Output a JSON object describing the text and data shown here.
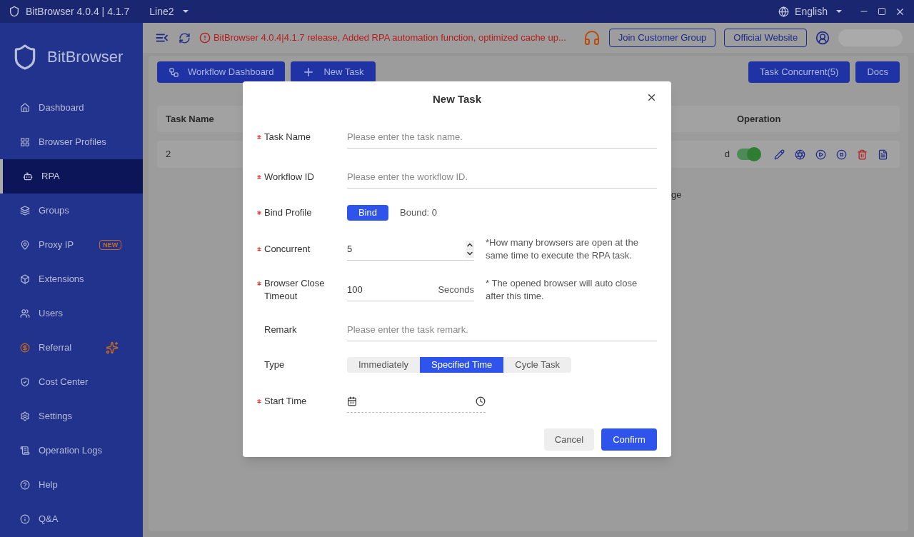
{
  "title_bar": {
    "app_title": "BitBrowser 4.0.4 | 4.1.7",
    "line_selector": "Line2",
    "language": "English"
  },
  "sidebar": {
    "brand": "BitBrowser",
    "items": [
      {
        "label": "Dashboard",
        "selected": false
      },
      {
        "label": "Browser Profiles",
        "selected": false
      },
      {
        "label": "RPA",
        "selected": true
      },
      {
        "label": "Groups",
        "selected": false
      },
      {
        "label": "Proxy IP",
        "selected": false,
        "badge": "NEW"
      },
      {
        "label": "Extensions",
        "selected": false
      },
      {
        "label": "Users",
        "selected": false
      },
      {
        "label": "Referral",
        "selected": false
      },
      {
        "label": "Cost Center",
        "selected": false
      },
      {
        "label": "Settings",
        "selected": false
      },
      {
        "label": "Operation Logs",
        "selected": false
      },
      {
        "label": "Help",
        "selected": false
      },
      {
        "label": "Q&A",
        "selected": false
      }
    ]
  },
  "toolbar": {
    "notice": "BitBrowser 4.0.4|4.1.7 release, Added RPA automation function, optimized cache up...",
    "buttons": [
      "Join Customer Group",
      "Official Website"
    ]
  },
  "actions": {
    "left": [
      "Workflow Dashboard",
      "New Task"
    ],
    "right": [
      "Task Concurrent(5)",
      "Docs"
    ]
  },
  "table": {
    "columns": [
      "Task Name",
      "Operation"
    ],
    "rows": [
      {
        "task_name": "2",
        "column_3": "d",
        "enabled": true
      }
    ],
    "footer_fragment": "ge"
  },
  "dialog": {
    "title": "New Task",
    "fields": [
      {
        "kind": "text",
        "label": "Task Name",
        "required": true,
        "placeholder": "Please enter the task name."
      },
      {
        "kind": "text",
        "label": "Workflow ID",
        "required": true,
        "placeholder": "Please enter the workflow ID."
      },
      {
        "kind": "bind",
        "label": "Bind Profile",
        "required": true,
        "button": "Bind",
        "count": "Bound: 0"
      },
      {
        "kind": "number",
        "label": "Concurrent",
        "required": true,
        "value": "5",
        "hint": "*How many browsers are open at the same time to execute the RPA task."
      },
      {
        "kind": "timeout",
        "label": "Browser Close Timeout",
        "required": true,
        "value": "100",
        "unit": "Seconds",
        "hint": "* The opened browser will auto close after this time."
      },
      {
        "kind": "text",
        "label": "Remark",
        "required": false,
        "placeholder": "Please enter the task remark."
      },
      {
        "kind": "segmented",
        "label": "Type",
        "required": false,
        "options": [
          {
            "label": "Immediately",
            "selected": false
          },
          {
            "label": "Specified Time",
            "selected": true
          },
          {
            "label": "Cycle Task",
            "selected": false
          }
        ]
      },
      {
        "kind": "datetime",
        "label": "Start Time",
        "required": true
      }
    ],
    "buttons": {
      "cancel": "Cancel",
      "confirm": "Confirm"
    }
  }
}
